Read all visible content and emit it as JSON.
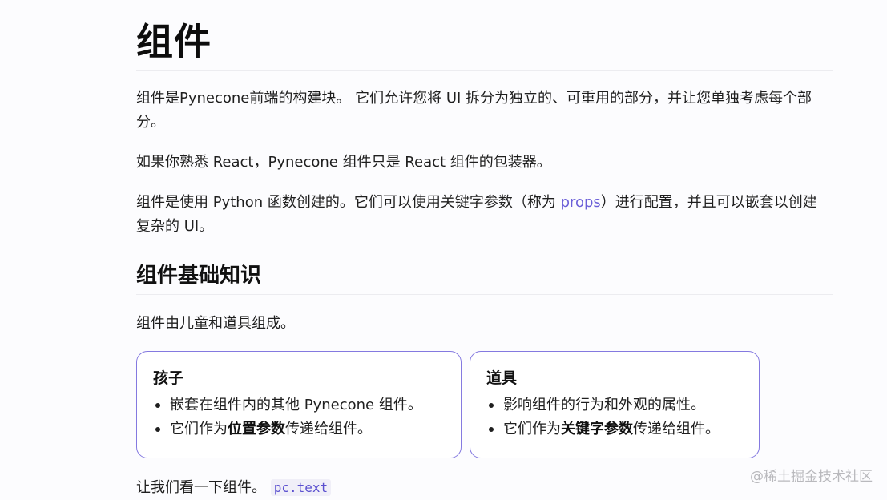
{
  "page": {
    "title": "组件",
    "paragraphs": {
      "p1": "组件是Pynecone前端的构建块。 它们允许您将 UI 拆分为独立的、可重用的部分，并让您单独考虑每个部分。",
      "p2": "如果你熟悉 React，Pynecone 组件只是 React 组件的包装器。",
      "p3_before": "组件是使用 Python 函数创建的。它们可以使用关键字参数（称为 ",
      "p3_link": "props",
      "p3_after": "）进行配置，并且可以嵌套以创建复杂的 UI。",
      "p4": "组件由儿童和道具组成。",
      "p5_text": "让我们看一下组件。 ",
      "p5_code": "pc.text"
    },
    "section_heading": "组件基础知识",
    "cards": [
      {
        "title": "孩子",
        "items": [
          {
            "text": "嵌套在组件内的其他 Pynecone 组件。"
          },
          {
            "before": "它们作为",
            "bold": "位置参数",
            "after": "传递给组件。"
          }
        ]
      },
      {
        "title": "道具",
        "items": [
          {
            "text": "影响组件的行为和外观的属性。"
          },
          {
            "before": "它们作为",
            "bold": "关键字参数",
            "after": "传递给组件。"
          }
        ]
      }
    ],
    "watermark": "@稀土掘金技术社区"
  },
  "colors": {
    "accent": "#6b5fd8",
    "card_border": "#8479e0",
    "code_text": "#5a4fcf"
  }
}
